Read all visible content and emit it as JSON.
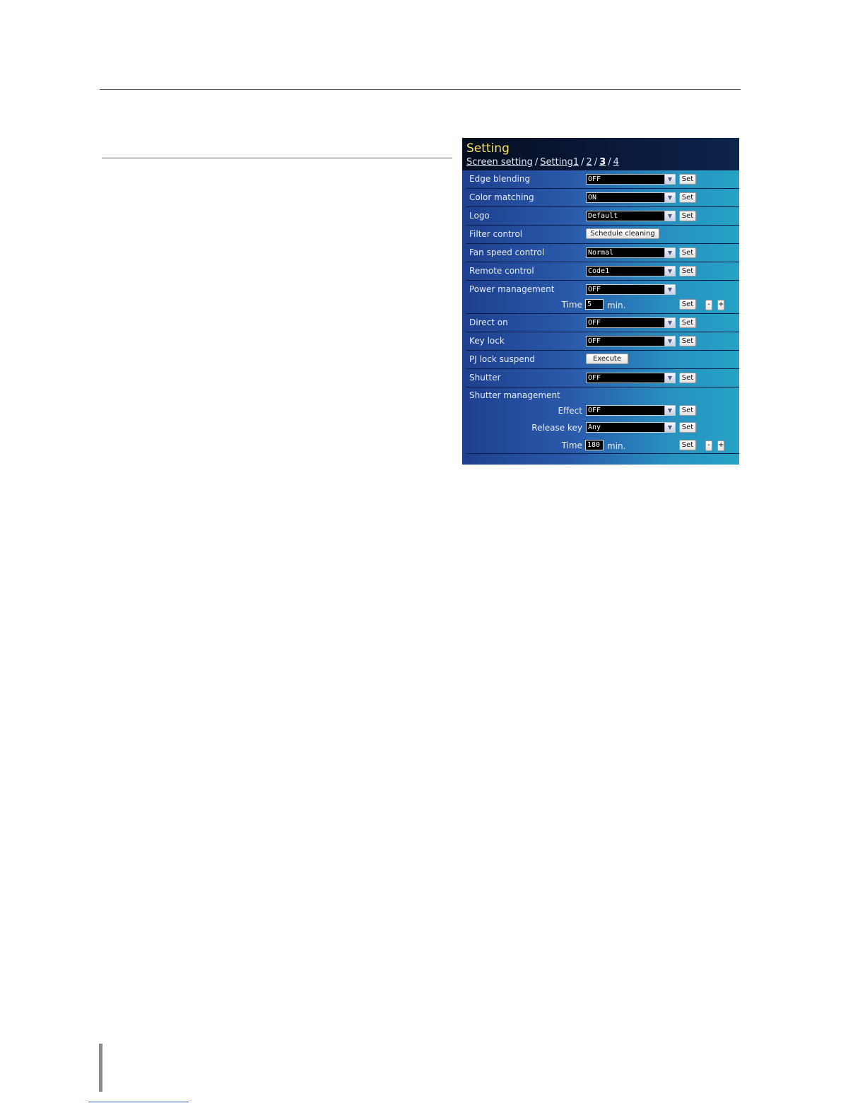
{
  "panel": {
    "title": "Setting",
    "breadcrumb": {
      "screen_setting": "Screen setting",
      "setting1": "Setting1",
      "page2": "2",
      "page3": "3",
      "page4": "4",
      "separator": "/"
    }
  },
  "rows": {
    "edge_blending": {
      "label": "Edge blending",
      "value": "OFF",
      "set": "Set"
    },
    "color_matching": {
      "label": "Color matching",
      "value": "ON",
      "set": "Set"
    },
    "logo": {
      "label": "Logo",
      "value": "Default",
      "set": "Set"
    },
    "filter_control": {
      "label": "Filter control",
      "button": "Schedule cleaning"
    },
    "fan_speed_control": {
      "label": "Fan speed control",
      "value": "Normal",
      "set": "Set"
    },
    "remote_control": {
      "label": "Remote control",
      "value": "Code1",
      "set": "Set"
    },
    "power_management": {
      "label": "Power management",
      "value": "OFF",
      "time_label": "Time",
      "time_value": "5",
      "unit": "min.",
      "set": "Set",
      "minus": "-",
      "plus": "+"
    },
    "direct_on": {
      "label": "Direct on",
      "value": "OFF",
      "set": "Set"
    },
    "key_lock": {
      "label": "Key lock",
      "value": "OFF",
      "set": "Set"
    },
    "pj_lock_suspend": {
      "label": "PJ lock suspend",
      "button": "Execute"
    },
    "shutter": {
      "label": "Shutter",
      "value": "OFF",
      "set": "Set"
    },
    "shutter_management": {
      "label": "Shutter management",
      "effect_label": "Effect",
      "effect_value": "OFF",
      "release_label": "Release key",
      "release_value": "Any",
      "time_label": "Time",
      "time_value": "180",
      "unit": "min.",
      "set": "Set",
      "minus": "-",
      "plus": "+"
    }
  },
  "icons": {
    "dropdown_arrow": "chevron-down-icon"
  }
}
